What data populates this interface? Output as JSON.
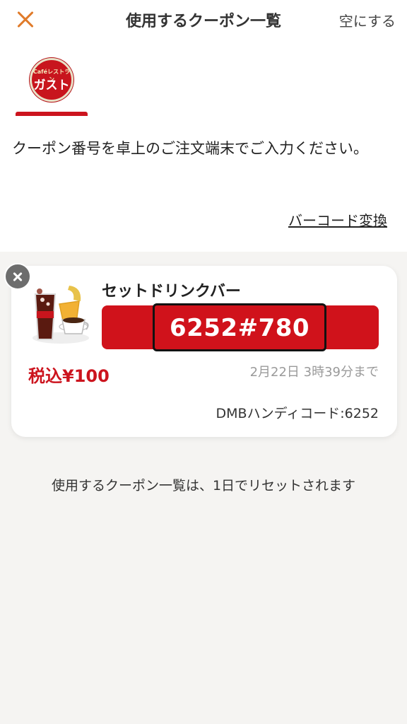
{
  "header": {
    "title": "使用するクーポン一覧",
    "clear_label": "空にする"
  },
  "brand": {
    "logo_small_text": "Caféレストラン",
    "logo_main_text": "ガスト"
  },
  "instruction": "クーポン番号を卓上のご注文端末でご入力ください。",
  "barcode_link": "バーコード変換",
  "coupon": {
    "name": "セットドリンクバー",
    "code": "6252#780",
    "price": "税込¥100",
    "expiry": "2月22日 3時39分まで",
    "handy_code": "DMBハンディコード:6252",
    "image_icon": "drink-bar-icon"
  },
  "footer_note": "使用するクーポン一覧は、1日でリセットされます",
  "colors": {
    "accent_red": "#cc141e",
    "close_orange": "#e07b2a",
    "background": "#f5f4f2"
  }
}
